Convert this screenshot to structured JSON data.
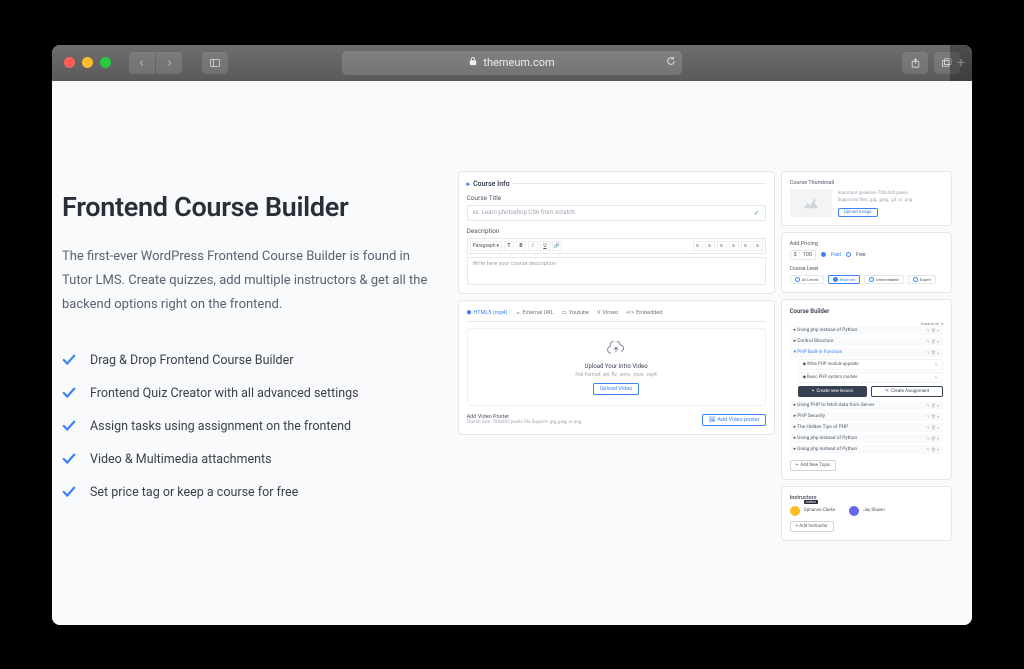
{
  "browser": {
    "domain": "themeum.com"
  },
  "page": {
    "heading": "Frontend Course Builder",
    "description": "The first-ever WordPress Frontend Course Builder is found in Tutor LMS. Create quizzes, add multiple instructors & get all the backend options right on the frontend.",
    "features": [
      "Drag & Drop Frontend Course Builder",
      "Frontend Quiz Creator with all advanced settings",
      "Assign tasks using assignment on the frontend",
      "Video & Multimedia attachments",
      "Set price tag or keep a course for free"
    ]
  },
  "mock": {
    "courseInfo": {
      "title": "Course Info",
      "courseTitleLabel": "Course Title",
      "courseTitlePlaceholder": "ex. Learn photoshop CS6 from scratch",
      "descLabel": "Description",
      "descPlaceholder": "Write here your course description",
      "paragraph": "Paragraph"
    },
    "video": {
      "tabs": [
        "HTML5 (mp4)",
        "External URL",
        "Youtube",
        "Vimeo",
        "Embedded"
      ],
      "uploadTitle": "Upload Your Intro Video",
      "uploadSub": "File Format:  avi, flv, .wmv, .mov, .mp4",
      "uploadBtn": "Upload Video",
      "posterLabel": "Add Video Poster",
      "posterSub": "Thumb Size: 700x430 pixels File Support: jpg, jpeg, or png",
      "posterBtn": "Add Video poster"
    },
    "thumbnail": {
      "title": "Course Thumbnail",
      "line1": "Important guideline 700x430 pixels",
      "line2": "Supported files .jpg, .jpeg, .gif, or .png",
      "btn": "Upload Image"
    },
    "pricing": {
      "title": "Add Pricing",
      "paidLabel": "Paid",
      "freeLabel": "Free",
      "levelLabel": "Course Level",
      "levels": [
        "All Levels",
        "Beginner",
        "Intermediate",
        "Expert"
      ]
    },
    "builder": {
      "title": "Course Builder",
      "expand": "Expand all",
      "items1": [
        "Using php instead of Python",
        "Control Structure",
        "PHP Built-in Function"
      ],
      "nested": [
        "Write PHP module appdate",
        "Basic PHP system module"
      ],
      "createLesson": "Create new lesson",
      "createAssign": "Create Assignment",
      "items2": [
        "Using PHP to fetch data from Server",
        "PHP Security",
        "The Hidden Tips of PHP",
        "Using php instead of Python",
        "Using php instead of Python"
      ],
      "addTopic": "Add New Topic"
    },
    "instructors": {
      "title": "Instructors",
      "names": [
        "Ophanne Clarke",
        "Jay Shawn"
      ],
      "author": "Author",
      "addBtn": "Add Instructor"
    }
  }
}
